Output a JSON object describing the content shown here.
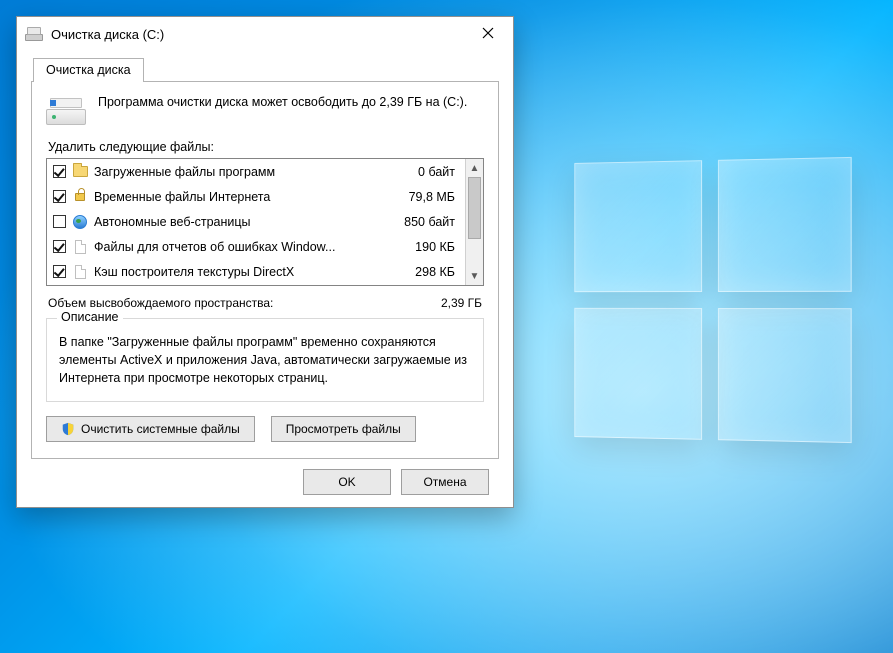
{
  "window": {
    "title": "Очистка диска  (C:)"
  },
  "tab": {
    "label": "Очистка диска"
  },
  "info": "Программа очистки диска может освободить до 2,39 ГБ на (C:).",
  "list_label": "Удалить следующие файлы:",
  "files": [
    {
      "name": "Загруженные файлы программ",
      "size": "0 байт",
      "checked": true,
      "icon": "folder"
    },
    {
      "name": "Временные файлы Интернета",
      "size": "79,8 МБ",
      "checked": true,
      "icon": "lock"
    },
    {
      "name": "Автономные веб-страницы",
      "size": "850 байт",
      "checked": false,
      "icon": "globe"
    },
    {
      "name": "Файлы для отчетов об ошибках Window...",
      "size": "190 КБ",
      "checked": true,
      "icon": "page"
    },
    {
      "name": "Кэш построителя текстуры DirectX",
      "size": "298 КБ",
      "checked": true,
      "icon": "page"
    }
  ],
  "total": {
    "label": "Объем высвобождаемого пространства:",
    "value": "2,39 ГБ"
  },
  "description": {
    "legend": "Описание",
    "text": "В папке \"Загруженные файлы программ\" временно сохраняются элементы ActiveX и приложения Java, автоматически загружаемые из Интернета при просмотре некоторых страниц."
  },
  "buttons": {
    "clean_system": "Очистить системные файлы",
    "view_files": "Просмотреть файлы",
    "ok": "OK",
    "cancel": "Отмена"
  }
}
